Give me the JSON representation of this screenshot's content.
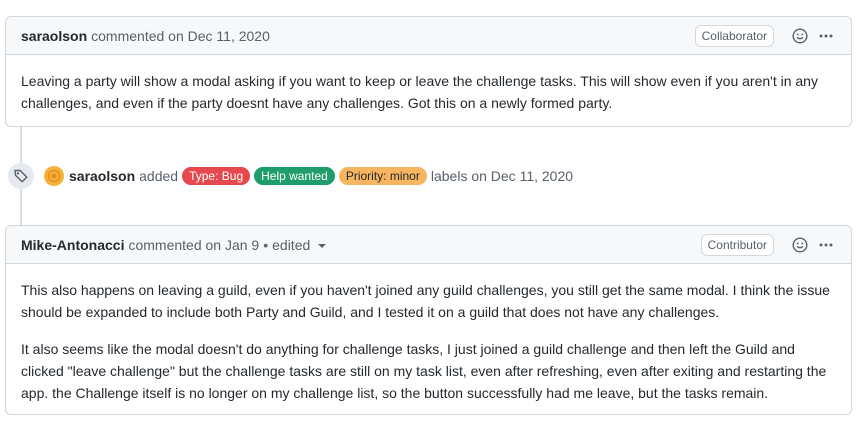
{
  "comment1": {
    "author": "saraolson",
    "action": "commented on Dec 11, 2020",
    "role": "Collaborator",
    "body": "Leaving a party will show a modal asking if you want to keep or leave the challenge tasks. This will show even if you aren't in any challenges, and even if the party doesnt have any challenges. Got this on a newly formed party."
  },
  "label_event": {
    "author": "saraolson",
    "added": "added",
    "labels": [
      {
        "name": "Type: Bug",
        "bg": "#e5484d",
        "fg": "#ffffff"
      },
      {
        "name": "Help wanted",
        "bg": "#1f9d6b",
        "fg": "#ffffff"
      },
      {
        "name": "Priority: minor",
        "bg": "#f6b55e",
        "fg": "#24292f"
      }
    ],
    "suffix": "labels on Dec 11, 2020"
  },
  "comment2": {
    "author": "Mike-Antonacci",
    "action": "commented on Jan 9",
    "separator": "•",
    "edited": "edited",
    "role": "Contributor",
    "paragraphs": [
      "This also happens on leaving a guild, even if you haven't joined any guild challenges, you still get the same modal. I think the issue should be expanded to include both Party and Guild, and I tested it on a guild that does not have any challenges.",
      "It also seems like the modal doesn't do anything for challenge tasks, I just joined a guild challenge and then left the Guild and clicked \"leave challenge\" but the challenge tasks are still on my task list, even after refreshing, even after exiting and restarting the app. the Challenge itself is no longer on my challenge list, so the button successfully had me leave, but the tasks remain."
    ]
  },
  "icons": {
    "reaction": "smiley-icon",
    "menu": "kebab-horizontal-icon",
    "tag": "tag-icon",
    "caret": "triangle-down-icon"
  },
  "colors": {
    "border": "#d0d7de",
    "header_bg": "#f6f8fa",
    "muted_text": "#57606a",
    "avatar": "#f2b33d"
  }
}
